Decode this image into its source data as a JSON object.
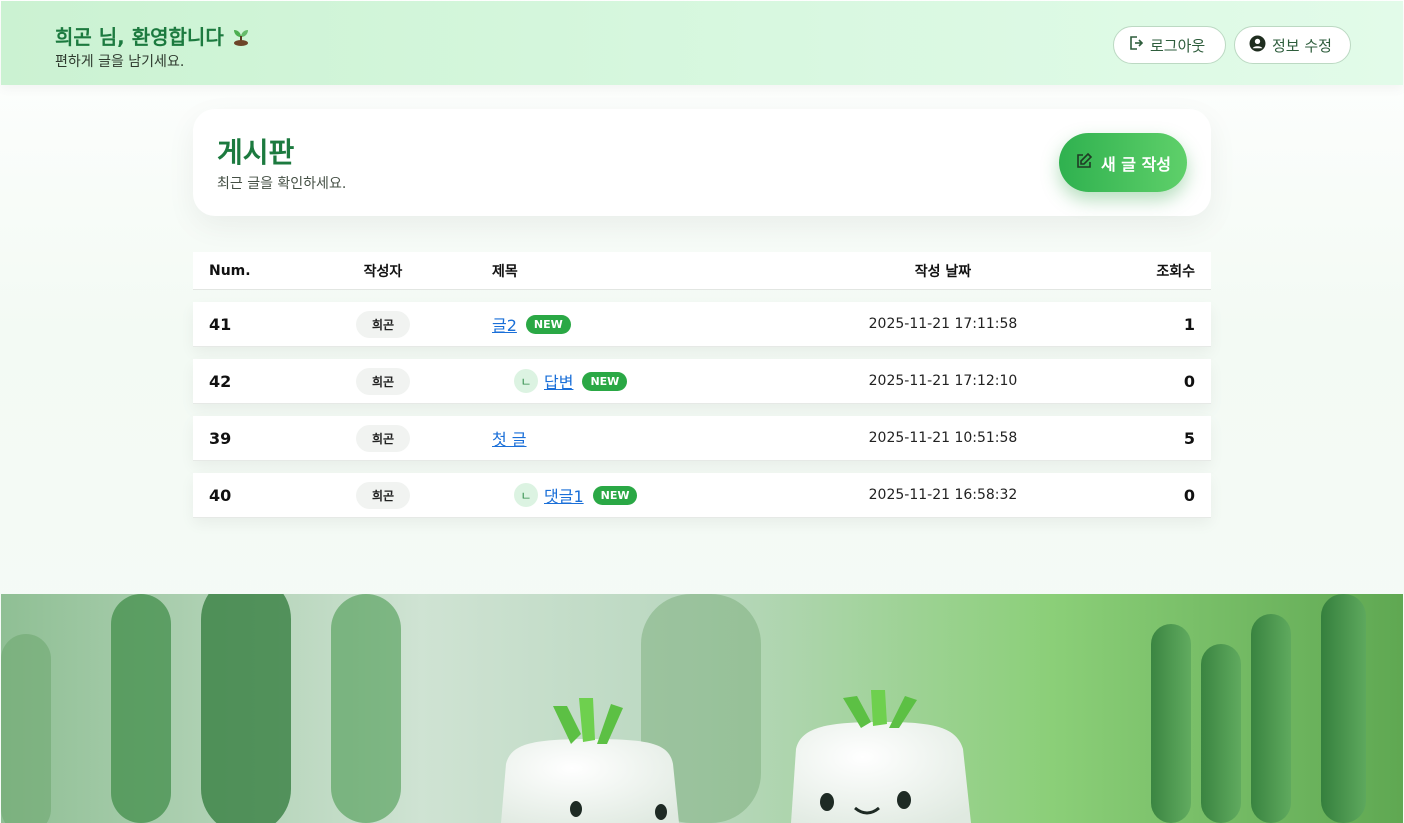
{
  "header": {
    "greeting": "희곤 님, 환영합니다",
    "subtitle": "편하게 글을 남기세요.",
    "logout_label": "로그아웃",
    "profile_label": "정보 수정"
  },
  "board": {
    "title": "게시판",
    "subtitle": "최근 글을 확인하세요.",
    "new_post_label": "새 글 작성"
  },
  "table": {
    "columns": [
      "Num.",
      "작성자",
      "제목",
      "작성 날짜",
      "조회수"
    ],
    "rows": [
      {
        "num": "41",
        "author": "희곤",
        "title": "글2",
        "is_reply": false,
        "new": "NEW",
        "date": "2025-11-21 17:11:58",
        "views": "1"
      },
      {
        "num": "42",
        "author": "희곤",
        "title": "답변",
        "is_reply": true,
        "reply_mark": "ㄴ",
        "new": "NEW",
        "date": "2025-11-21 17:12:10",
        "views": "0"
      },
      {
        "num": "39",
        "author": "희곤",
        "title": "첫 글",
        "is_reply": false,
        "new": "",
        "date": "2025-11-21 10:51:58",
        "views": "5"
      },
      {
        "num": "40",
        "author": "희곤",
        "title": "댓글1",
        "is_reply": true,
        "reply_mark": "ㄴ",
        "new": "NEW",
        "date": "2025-11-21 16:58:32",
        "views": "0"
      }
    ]
  },
  "colors": {
    "brand_green": "#1c7a3f",
    "accent_green": "#2fb14f",
    "link_blue": "#1a6fd8",
    "badge_green": "#2aa845"
  },
  "icons": {
    "sprout": "sprout-icon",
    "logout": "logout-icon",
    "profile": "user-circle-icon",
    "edit": "edit-icon",
    "reply": "reply-mark-icon"
  }
}
